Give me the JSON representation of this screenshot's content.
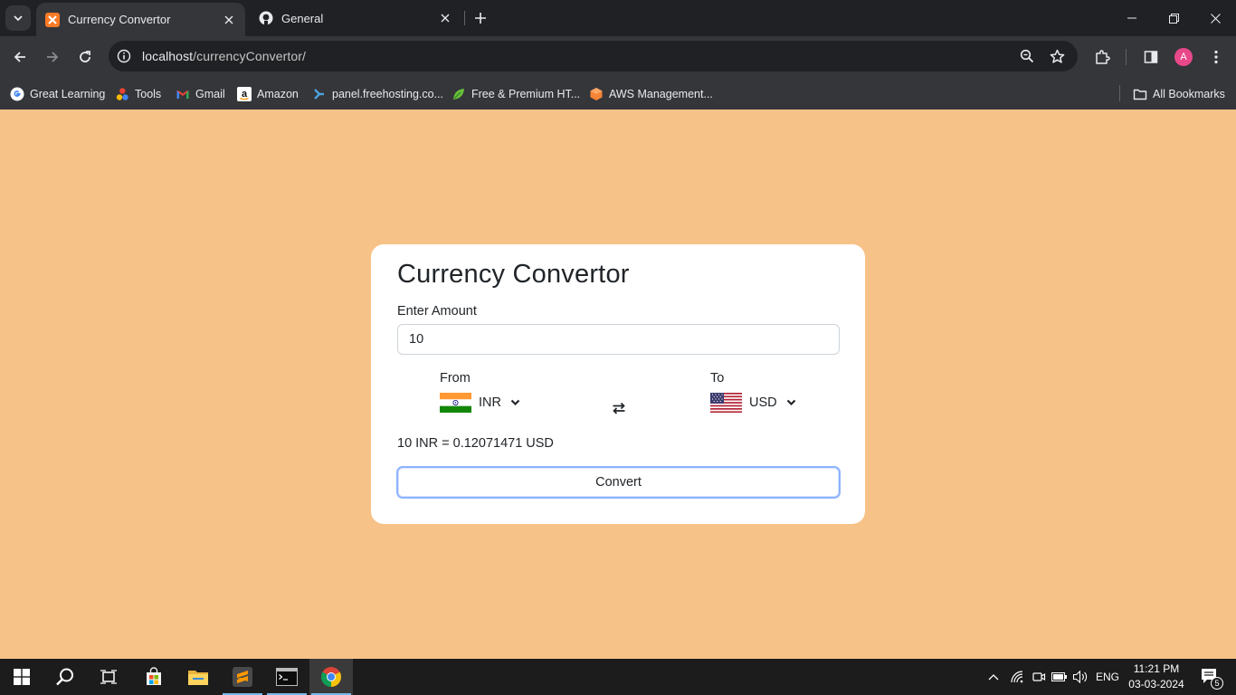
{
  "browser": {
    "tabs": [
      {
        "title": "Currency Convertor",
        "active": true,
        "favicon": "xampp-icon"
      },
      {
        "title": "General",
        "active": false,
        "favicon": "github-icon"
      }
    ],
    "url_host": "localhost",
    "url_path": "/currencyConvertor/",
    "profile_initial": "A",
    "bookmarks": [
      {
        "label": "Great Learning",
        "icon": "google-icon"
      },
      {
        "label": "Tools",
        "icon": "tools-icon"
      },
      {
        "label": "Gmail",
        "icon": "gmail-icon"
      },
      {
        "label": "Amazon",
        "icon": "amazon-icon"
      },
      {
        "label": "panel.freehosting.co...",
        "icon": "freehosting-icon"
      },
      {
        "label": "Free & Premium HT...",
        "icon": "leaf-icon"
      },
      {
        "label": "AWS Management...",
        "icon": "aws-icon"
      }
    ],
    "all_bookmarks": "All Bookmarks"
  },
  "app": {
    "title": "Currency Convertor",
    "amount_label": "Enter Amount",
    "amount_value": "10",
    "from_label": "From",
    "from_currency": "INR",
    "to_label": "To",
    "to_currency": "USD",
    "result": "10 INR = 0.12071471 USD",
    "convert_label": "Convert"
  },
  "taskbar": {
    "language": "ENG",
    "time": "11:21 PM",
    "date": "03-03-2024",
    "notification_count": "5"
  },
  "colors": {
    "page_background": "#f7c288",
    "card_background": "#ffffff",
    "button_focus_border": "#8eb3ff"
  }
}
